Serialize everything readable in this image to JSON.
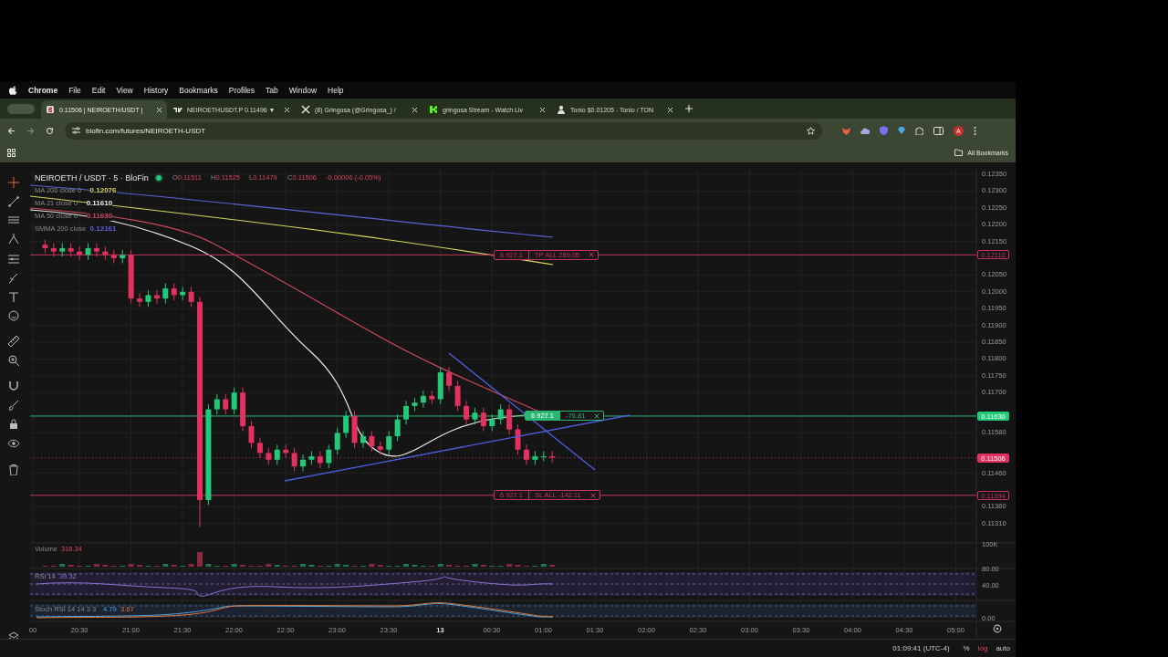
{
  "menu_bar": {
    "app": "Chrome",
    "items": [
      "File",
      "Edit",
      "View",
      "History",
      "Bookmarks",
      "Profiles",
      "Tab",
      "Window",
      "Help"
    ]
  },
  "tabs": [
    {
      "title": "0.11506 | NEIROETH/USDT | ",
      "selected": true
    },
    {
      "title": "NEIROETHUSDT.P 0.11496 ▼",
      "selected": false
    },
    {
      "title": "(8) Gringosa (@Gringosa_) / ",
      "selected": false
    },
    {
      "title": "gringosa Stream - Watch Liv",
      "selected": false
    },
    {
      "title": "Tonio $0.01205 - Tonio / TON",
      "selected": false
    }
  ],
  "address_bar": {
    "url": "blofin.com/futures/NEIROETH-USDT",
    "profile_initial": "A"
  },
  "bookmarks_bar": {
    "label": "All Bookmarks"
  },
  "chart": {
    "symbol": "NEIROETH / USDT · 5 · BloFin",
    "ohlc": [
      {
        "label": "O",
        "value": "0.11511"
      },
      {
        "label": "H",
        "value": "0.11525"
      },
      {
        "label": "L",
        "value": "0.11479"
      },
      {
        "label": "C",
        "value": "0.11506"
      }
    ],
    "change": "-0.00006 (-0.05%)",
    "indicators": [
      {
        "name": "MA 200 close 0",
        "value": "0.12076",
        "color": "#d6d45a"
      },
      {
        "name": "MA 21 close 0",
        "value": "0.11610",
        "color": "#ececec"
      },
      {
        "name": "MA 50 close 0",
        "value": "0.11630",
        "color": "#d2485a"
      },
      {
        "name": "SMMA 200 close",
        "value": "0.12161",
        "color": "#5a63d8"
      }
    ],
    "price_ticks": [
      "0.12350",
      "0.12300",
      "0.12250",
      "0.12200",
      "0.12150",
      "0.12050",
      "0.12000",
      "0.11950",
      "0.11900",
      "0.11850",
      "0.11800",
      "0.11750",
      "0.11700",
      "0.11580",
      "0.11460",
      "0.11360",
      "0.11310"
    ],
    "price_labels": [
      {
        "value": "0.12110",
        "kind": "tp"
      },
      {
        "value": "0.11630",
        "kind": "entry"
      },
      {
        "value": "0.11506",
        "kind": "last"
      },
      {
        "value": "0.11394",
        "kind": "sl"
      }
    ],
    "orders": [
      {
        "kind": "tp",
        "quantity": "6 927.1",
        "text": "TP ALL 289.05"
      },
      {
        "kind": "entry",
        "quantity": "6 927.1",
        "text": "-76.81"
      },
      {
        "kind": "sl",
        "quantity": "6 927.1",
        "text": "SL ALL -142.11"
      }
    ],
    "time_ticks": [
      "00",
      "20:30",
      "21:00",
      "21:30",
      "22:00",
      "22:30",
      "23:00",
      "23:30",
      "13",
      "00:30",
      "01:00",
      "01:30",
      "02:00",
      "02:30",
      "03:00",
      "03:30",
      "04:00",
      "04:30",
      "05:00"
    ]
  },
  "volume": {
    "label": "Volume",
    "value": "316.34",
    "tick": "100K"
  },
  "rsi": {
    "label": "RSI 14",
    "value": "39.32",
    "ticks": [
      "80.00",
      "40.00"
    ]
  },
  "stoch_rsi": {
    "label": "Stoch RSI 14 14 3 3",
    "k": "4.79",
    "d": "3.67",
    "tick": "0.00"
  },
  "status": {
    "time": "01:09:41 (UTC-4)",
    "options": [
      {
        "label": "%",
        "selected": false
      },
      {
        "label": "log",
        "selected": true
      },
      {
        "label": "auto",
        "selected": false
      }
    ]
  }
}
